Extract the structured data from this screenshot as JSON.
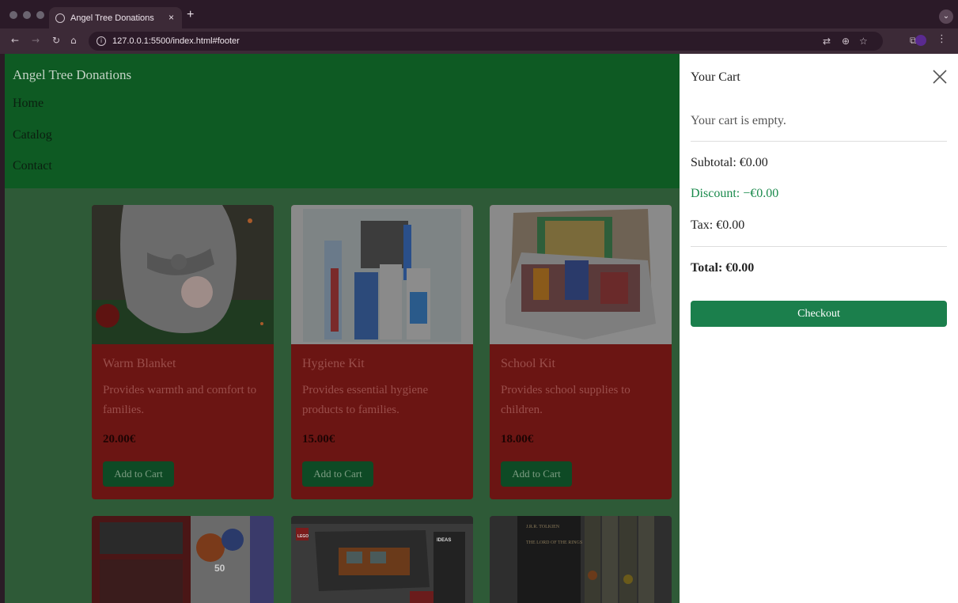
{
  "browser": {
    "tab_title": "Angel Tree Donations",
    "tab_close": "×",
    "new_tab": "+",
    "url": "127.0.0.1:5500/index.html#footer"
  },
  "site": {
    "brand": "Angel Tree Donations",
    "nav": [
      "Home",
      "Catalog",
      "Contact"
    ]
  },
  "products": [
    {
      "title": "Warm Blanket",
      "desc": "Provides warmth and comfort to families.",
      "price": "20.00€",
      "button": "Add to Cart"
    },
    {
      "title": "Hygiene Kit",
      "desc": "Provides essential hygiene products to families.",
      "price": "15.00€",
      "button": "Add to Cart"
    },
    {
      "title": "School Kit",
      "desc": "Provides school supplies to children.",
      "price": "18.00€",
      "button": "Add to Cart"
    }
  ],
  "product_images_row2": {
    "art_set_number": "50",
    "lego_logo": "LEGO",
    "lego_badge": "IDEAS",
    "book_author": "J.R.R. TOLKIEN",
    "book_title": "THE LORD OF THE RINGS"
  },
  "cart": {
    "title": "Your Cart",
    "empty_message": "Your cart is empty.",
    "subtotal": "Subtotal: €0.00",
    "discount": "Discount: −€0.00",
    "tax": "Tax: €0.00",
    "total": "Total: €0.00",
    "checkout": "Checkout"
  },
  "colors": {
    "header_green": "#0e5a23",
    "card_red": "#6b1513",
    "checkout_green": "#1b7f4c",
    "discount_green": "#1a8a4c"
  }
}
